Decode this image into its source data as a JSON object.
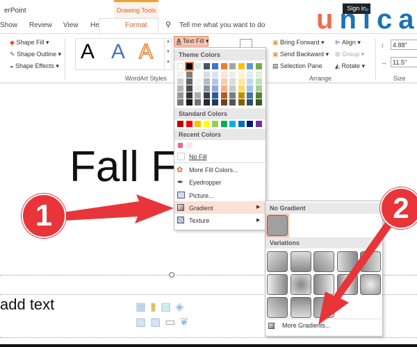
{
  "title_bar": {
    "app_title": "erPoint",
    "context_tab": "Drawing Tools",
    "sign_in": "Sign in"
  },
  "logo": {
    "text": "unica",
    "colors": {
      "u": "#ef6c4c",
      "rest": "#1a73b8"
    }
  },
  "tabs": [
    "Show",
    "Review",
    "View",
    "Help",
    "Format"
  ],
  "active_tab": "Format",
  "tell_me": "Tell me what you want to do",
  "ribbon": {
    "shape_fill": "Shape Fill",
    "shape_outline": "Shape Outline",
    "shape_effects": "Shape Effects",
    "wordart_label": "WordArt Styles",
    "wordart_letter": "A",
    "text_fill": "Text Fill",
    "bring_forward": "Bring Forward",
    "send_backward": "Send Backward",
    "selection_pane": "Selection Pane",
    "align": "Align",
    "group": "Group",
    "rotate": "Rotate",
    "arrange_label": "Arrange",
    "height": "4.88\"",
    "width": "11.5\"",
    "size_label": "Size"
  },
  "text_fill_menu": {
    "theme_colors_label": "Theme Colors",
    "theme_top": [
      "#ffffff",
      "#000000",
      "#e7e6e6",
      "#44546a",
      "#4472c4",
      "#ed7d31",
      "#a5a5a5",
      "#ffc000",
      "#5b9bd5",
      "#70ad47"
    ],
    "standard_colors_label": "Standard Colors",
    "standard": [
      "#c00000",
      "#ff0000",
      "#ffc000",
      "#ffff00",
      "#92d050",
      "#00b050",
      "#00b0f0",
      "#0070c0",
      "#002060",
      "#7030a0"
    ],
    "recent_colors_label": "Recent Colors",
    "recent": [
      "#f06292",
      "#fbe9f0"
    ],
    "no_fill": "No Fill",
    "more_fill_colors": "More Fill Colors...",
    "eyedropper": "Eyedropper",
    "picture": "Picture...",
    "gradient": "Gradient",
    "texture": "Texture"
  },
  "gradient_menu": {
    "no_gradient_label": "No Gradient",
    "variations_label": "Variations",
    "more_gradients": "More Gradients..."
  },
  "slide": {
    "title_text": "Fall F   s",
    "body_placeholder": "add text"
  },
  "callouts": [
    {
      "number": "1",
      "color": "#e8353a"
    },
    {
      "number": "2",
      "color": "#e8353a"
    }
  ]
}
